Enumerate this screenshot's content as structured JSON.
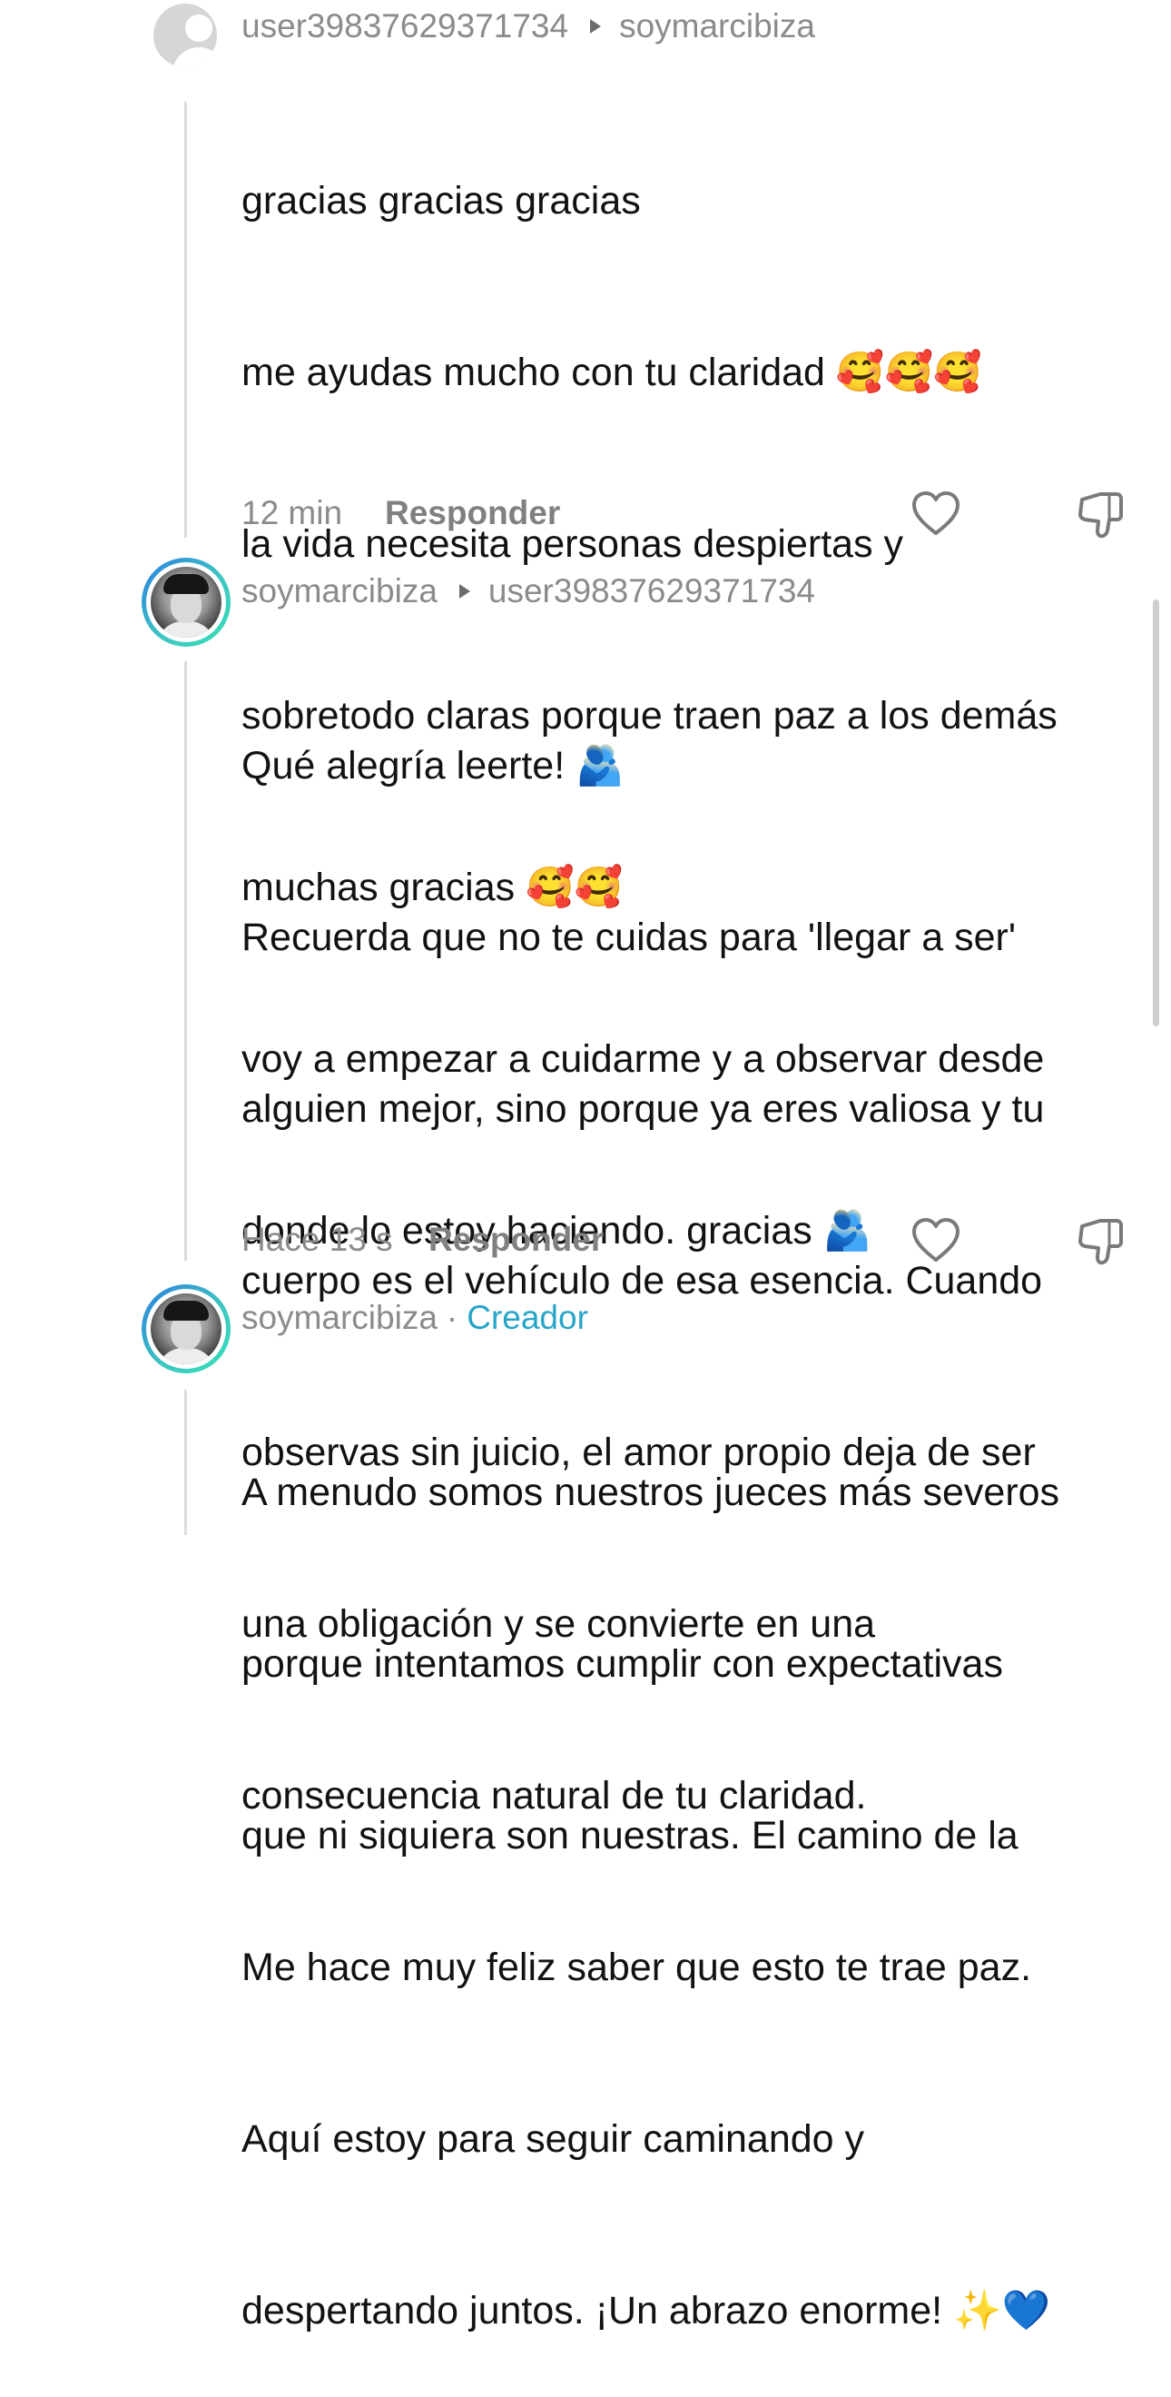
{
  "comments": [
    {
      "author": "user39837629371734",
      "reply_to": "soymarcibiza",
      "lines": [
        "gracias gracias gracias",
        "me ayudas mucho con tu claridad 🥰🥰🥰",
        "la vida necesita personas despiertas y",
        "sobretodo claras porque traen paz a los demás",
        "muchas gracias 🥰🥰",
        "voy a empezar a cuidarme y a observar desde",
        "donde lo estoy haciendo. gracias 🫂"
      ],
      "time": "12 min",
      "reply_label": "Responder"
    },
    {
      "author": "soymarcibiza",
      "reply_to": "user39837629371734",
      "lines": [
        "Qué alegría leerte! 🫂",
        "Recuerda que no te cuidas para 'llegar a ser'",
        "alguien mejor, sino porque ya eres valiosa y tu",
        "cuerpo es el vehículo de esa esencia. Cuando",
        "observas sin juicio, el amor propio deja de ser",
        "una obligación y se convierte en una",
        "consecuencia natural de tu claridad.",
        "Me hace muy feliz saber que esto te trae paz.",
        "Aquí estoy para seguir caminando y",
        "despertando juntos. ¡Un abrazo enorme! ✨💙"
      ],
      "time": "Hace 13 s",
      "reply_label": "Responder"
    },
    {
      "author": "soymarcibiza",
      "separator": "·",
      "badge": "Creador",
      "lines": [
        "A menudo somos nuestros jueces más severos",
        "porque intentamos cumplir con expectativas",
        "que ni siquiera son nuestras. El camino de la"
      ]
    }
  ],
  "icons": {
    "like": "heart-outline-icon",
    "dislike": "thumbs-down-outline-icon",
    "reply_arrow": "triangle-right-icon"
  },
  "colors": {
    "text": "#121212",
    "meta": "#8b8b8b",
    "creator_badge": "#27a5c8",
    "thread_line": "#dcdcdc"
  }
}
